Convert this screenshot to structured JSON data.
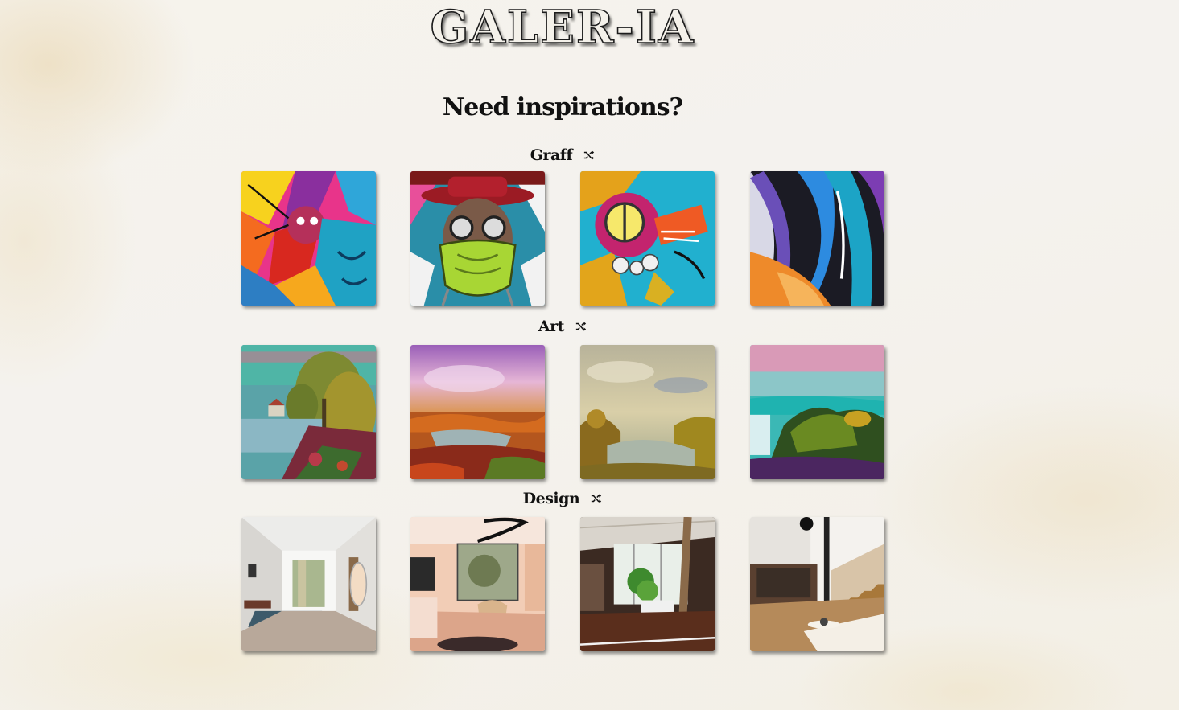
{
  "header": {
    "logo_text": "GALER-IA",
    "headline": "Need inspirations?"
  },
  "sections": [
    {
      "title": "Graff",
      "shuffle_icon": "shuffle-icon",
      "images": [
        "graffiti-image-1",
        "graffiti-image-2",
        "graffiti-image-3",
        "graffiti-image-4"
      ]
    },
    {
      "title": "Art",
      "shuffle_icon": "shuffle-icon",
      "images": [
        "art-image-1",
        "art-image-2",
        "art-image-3",
        "art-image-4"
      ]
    },
    {
      "title": "Design",
      "shuffle_icon": "shuffle-icon",
      "images": [
        "design-image-1",
        "design-image-2",
        "design-image-3",
        "design-image-4"
      ]
    }
  ],
  "colors": {
    "background": "#f4f2ee",
    "text": "#111111",
    "watercolor_stain": "#e7d2a8"
  }
}
